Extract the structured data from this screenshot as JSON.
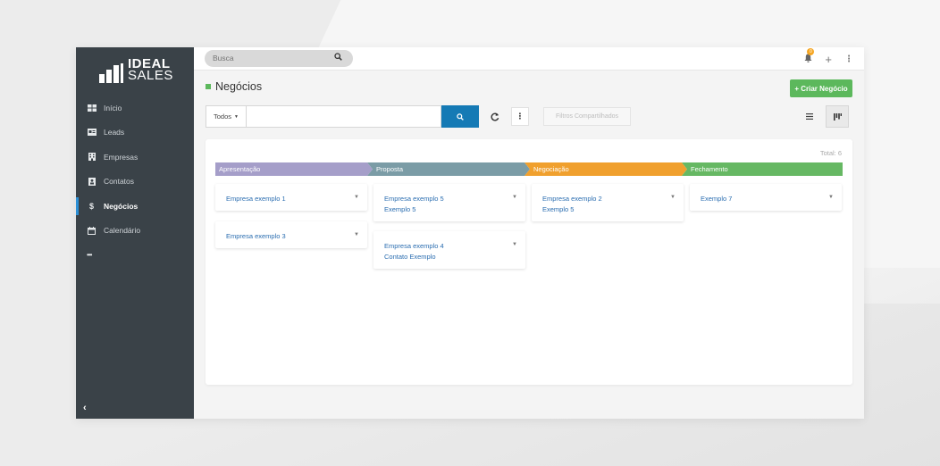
{
  "brand": {
    "line1": "IDEAL",
    "line2": "SALES"
  },
  "sidebar": {
    "items": [
      {
        "label": "Início",
        "icon": "grid-icon"
      },
      {
        "label": "Leads",
        "icon": "contact-card-icon"
      },
      {
        "label": "Empresas",
        "icon": "building-icon"
      },
      {
        "label": "Contatos",
        "icon": "address-book-icon"
      },
      {
        "label": "Negócios",
        "icon": "dollar-icon",
        "active": true
      },
      {
        "label": "Calendário",
        "icon": "calendar-icon"
      },
      {
        "label": "•••",
        "icon": "more-icon"
      }
    ],
    "collapse_label": "‹"
  },
  "topbar": {
    "search_placeholder": "Busca",
    "notification_count": "0"
  },
  "page": {
    "title": "Negócios",
    "create_button": "+ Criar Negócio"
  },
  "filters": {
    "scope_label": "Todos",
    "shared_filters_label": "Filtros Compartilhados"
  },
  "board": {
    "total_label": "Total: 6",
    "stages": [
      {
        "name": "Apresentação",
        "color": "#a59ec9"
      },
      {
        "name": "Proposta",
        "color": "#7b9ca6"
      },
      {
        "name": "Negociação",
        "color": "#f0a02e"
      },
      {
        "name": "Fechamento",
        "color": "#66b863"
      }
    ],
    "cards": [
      {
        "stage": 0,
        "line1": "Empresa exemplo 1",
        "line2": ""
      },
      {
        "stage": 0,
        "line1": "Empresa exemplo 3",
        "line2": ""
      },
      {
        "stage": 1,
        "line1": "Empresa exemplo 5",
        "line2": "Exemplo 5"
      },
      {
        "stage": 1,
        "line1": "Empresa exemplo 4",
        "line2": "Contato Exemplo"
      },
      {
        "stage": 2,
        "line1": "Empresa exemplo 2",
        "line2": "Exemplo 5"
      },
      {
        "stage": 3,
        "line1": "Exemplo 7",
        "line2": ""
      }
    ]
  }
}
